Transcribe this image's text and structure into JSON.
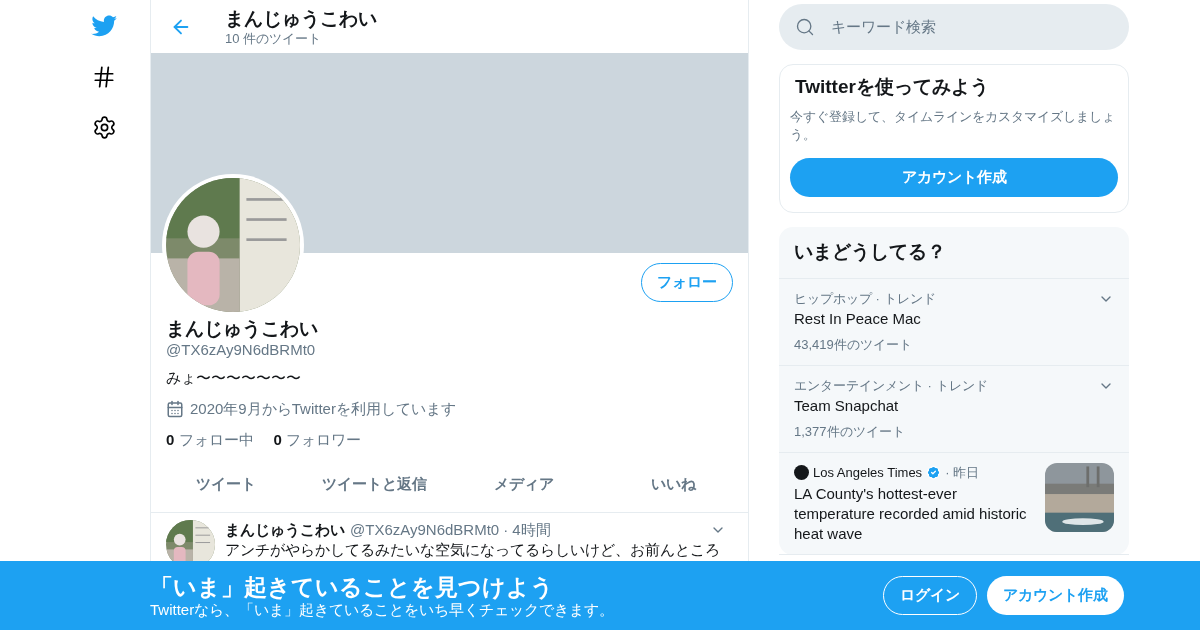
{
  "header": {
    "title": "まんじゅうこわい",
    "subtitle": "10 件のツイート"
  },
  "profile": {
    "name": "まんじゅうこわい",
    "handle": "@TX6zAy9N6dBRMt0",
    "bio": "みょ〜〜〜〜〜〜〜",
    "joined": "2020年9月からTwitterを利用しています",
    "following_count": "0",
    "following_label": "フォロー中",
    "followers_count": "0",
    "followers_label": "フォロワー",
    "follow_button": "フォロー"
  },
  "tabs": [
    {
      "label": "ツイート"
    },
    {
      "label": "ツイートと返信"
    },
    {
      "label": "メディア"
    },
    {
      "label": "いいね"
    }
  ],
  "tweet": {
    "name": "まんじゅうこわい",
    "handle": "@TX6zAy9N6dBRMt0",
    "separator": "·",
    "time": "4時間",
    "text": "アンチがやらかしてるみたいな空気になってるらしいけど、お前んところ"
  },
  "search": {
    "placeholder": "キーワード検索"
  },
  "signup_card": {
    "title": "Twitterを使ってみよう",
    "text": "今すぐ登録して、タイムラインをカスタマイズしましょう。",
    "button": "アカウント作成"
  },
  "trends": {
    "title": "いまどうしてる？",
    "items": [
      {
        "kind": "trend",
        "context": "ヒップホップ · トレンド",
        "name": "Rest In Peace Mac",
        "count": "43,419件のツイート"
      },
      {
        "kind": "trend",
        "context": "エンターテインメント · トレンド",
        "name": "Team Snapchat",
        "count": "1,377件のツイート"
      },
      {
        "kind": "news",
        "source": "Los Angeles Times",
        "separator": "·",
        "time": "昨日",
        "name": "LA County's hottest-ever temperature recorded amid historic heat wave"
      }
    ]
  },
  "bottom_bar": {
    "title": "「いま」起きていることを見つけよう",
    "subtitle": "Twitterなら、「いま」起きていることをいち早くチェックできます。",
    "login": "ログイン",
    "signup": "アカウント作成"
  }
}
